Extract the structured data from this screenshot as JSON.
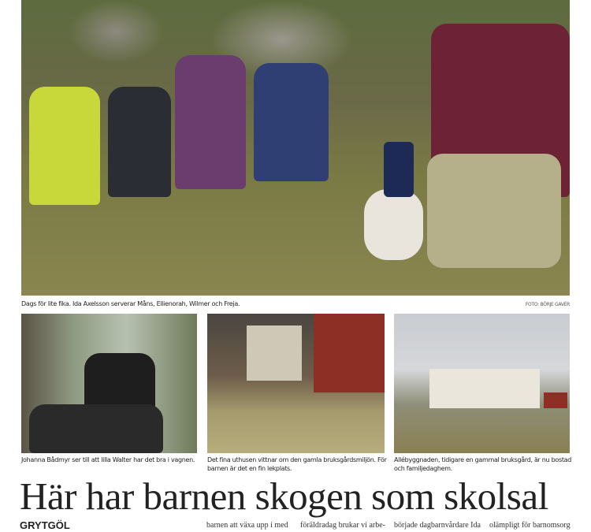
{
  "main_photo": {
    "caption": "Dags för lite fika. Ida Axelsson serverar Måns, Ellienorah, Wilmer och Freja.",
    "credit": "FOTO: BÖRJE GAVÉR"
  },
  "photos": [
    {
      "caption": "Johanna Bådmyr ser till att lilla Walter har det bra i vagnen."
    },
    {
      "caption": "Det fina uthusen vittnar om den gamla bruksgårdsmiljön. För barnen är det en fin lekplats."
    },
    {
      "caption": "Allébyggnaden, tidigare en gammal bruksgård, är nu bostad och familjedaghem."
    }
  ],
  "article": {
    "headline": "Här har barnen skogen som skolsal",
    "dateline": "GRYTGÖL",
    "columns": [
      "barnen att växa upp i med",
      "föräldradag brukar vi arbe-",
      "började dagbarnvårdare Ida",
      "olämpligt för barnomsorg"
    ]
  }
}
